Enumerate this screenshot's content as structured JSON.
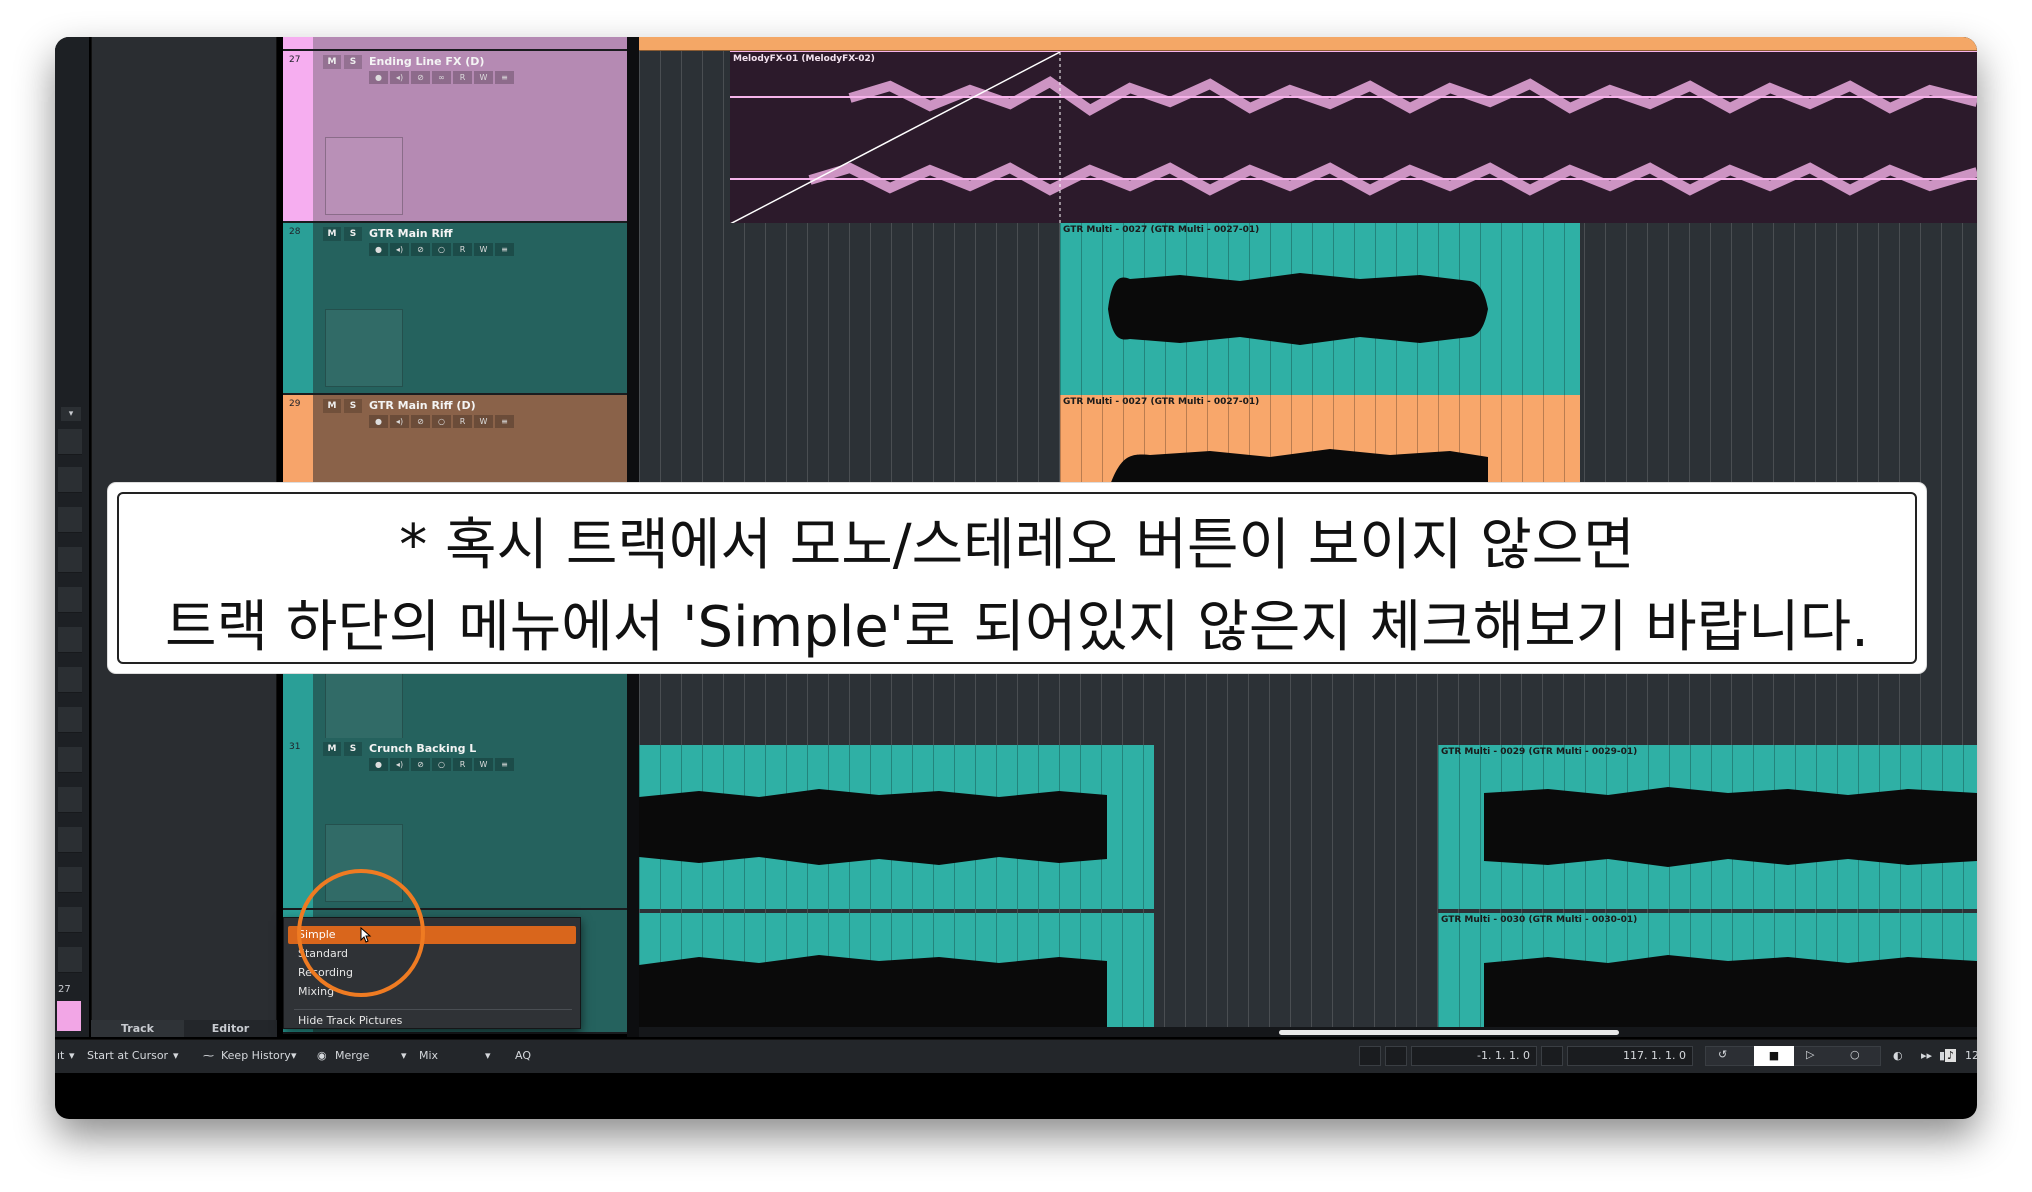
{
  "tracks": [
    {
      "number": "27",
      "name": "Ending Line FX (D)",
      "color": "#f6aef0",
      "body": "#b58ab3"
    },
    {
      "number": "28",
      "name": "GTR Main Riff",
      "color": "#2a9f97",
      "body": "#25625e"
    },
    {
      "number": "29",
      "name": "GTR Main Riff (D)",
      "color": "#f7a46a",
      "body": "#8a6249"
    },
    {
      "number": "31",
      "name": "Crunch Backing L",
      "color": "#2a9f97",
      "body": "#25625e"
    }
  ],
  "track_buttons": {
    "mute": "M",
    "solo": "S",
    "read": "R",
    "write": "W"
  },
  "clips": [
    {
      "name": "MelodyFX-01 (MelodyFX-02)"
    },
    {
      "name": "GTR Multi - 0027 (GTR Multi - 0027-01)"
    },
    {
      "name": "GTR Multi - 0027 (GTR Multi - 0027-01)"
    },
    {
      "name": "GTR Multi - 0029 (GTR Multi - 0029-01)"
    },
    {
      "name": "GTR Multi - 0030 (GTR Multi - 0030-01)"
    }
  ],
  "popup_menu": {
    "items": [
      "Simple",
      "Standard",
      "Recording",
      "Mixing"
    ],
    "selected": "Simple",
    "extra": "Hide Track Pictures"
  },
  "inspector_tabs": {
    "track": "Track",
    "editor": "Editor"
  },
  "left_strip_number": "27",
  "toolbar": {
    "frag": "ıt",
    "start_at_cursor": "Start at Cursor",
    "keep_history": "Keep History",
    "merge": "Merge",
    "mix": "Mix",
    "aq": "AQ",
    "left_locator": "-1.  1.  1.    0",
    "right_locator": "117.  1.  1.    0",
    "edge_number": "12"
  },
  "caption": {
    "line1": "* 혹시 트랙에서 모노/스테레오 버튼이 보이지 않으면",
    "line2": "트랙 하단의 메뉴에서 'Simple'로 되어있지 않은지 체크해보기 바랍니다."
  },
  "colors": {
    "accent_orange": "#d9661c",
    "highlight_circle": "#ef7b22",
    "teal_clip": "#2fb0a5",
    "orange_clip": "#f8a76b",
    "pink_clip_bg": "#2c1a2b",
    "pink_wave": "#f6b3ea"
  }
}
